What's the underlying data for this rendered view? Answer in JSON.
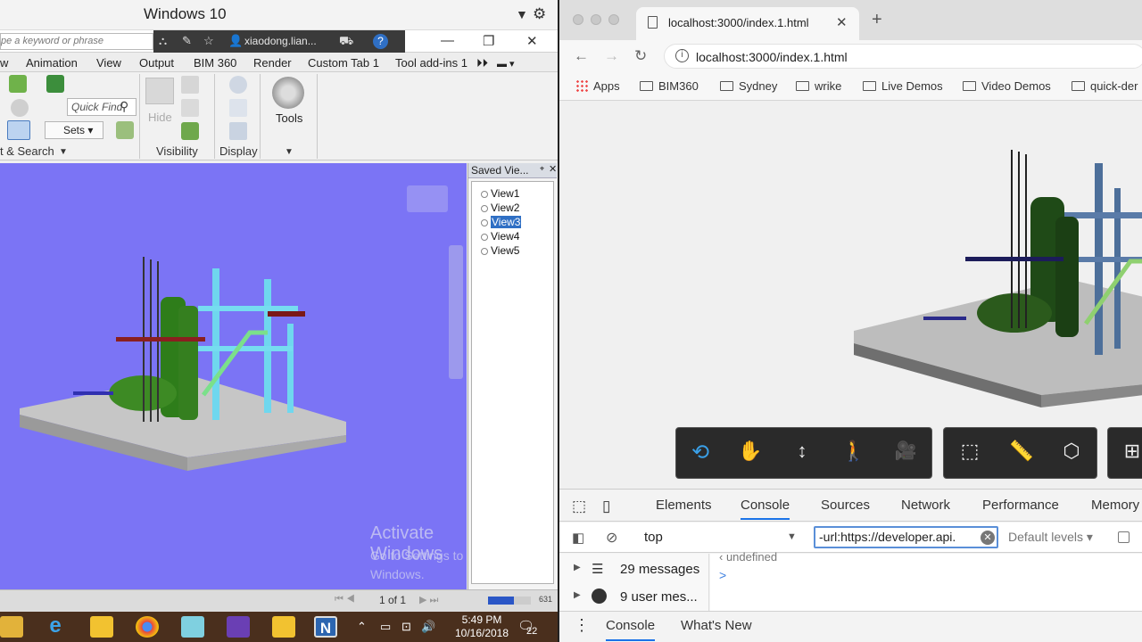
{
  "navisworks": {
    "window_title": "Windows 10",
    "search_placeholder": "pe a keyword or phrase",
    "user": "xiaodong.lian...",
    "menu": [
      "w",
      "Animation",
      "View",
      "Output",
      "BIM 360",
      "Render",
      "Custom Tab 1",
      "Tool add-ins 1"
    ],
    "ribbon": {
      "quick_find": "Quick Find",
      "sets": "Sets",
      "hide": "Hide",
      "tools": "Tools",
      "groups": [
        "t & Search",
        "Visibility",
        "Display"
      ]
    },
    "saved_views": {
      "title": "Saved Vie...",
      "items": [
        {
          "label": "View1",
          "selected": false
        },
        {
          "label": "View2",
          "selected": false
        },
        {
          "label": "View3",
          "selected": true
        },
        {
          "label": "View4",
          "selected": false
        },
        {
          "label": "View5",
          "selected": false
        }
      ]
    },
    "watermark": {
      "title": "Activate Windows",
      "subtitle": "Go to Settings to activate Windows."
    },
    "status": {
      "page": "1 of 1",
      "memory": "631"
    },
    "viewport_bg": "#7b74f5"
  },
  "taskbar": {
    "time": "5:49 PM",
    "date": "10/16/2018",
    "notifications": "22",
    "apps": [
      "file-explorer",
      "internet-explorer",
      "help",
      "chrome",
      "docs",
      "visual-studio",
      "help-2",
      "navisworks"
    ]
  },
  "chrome": {
    "tab_title": "localhost:3000/index.1.html",
    "url": "localhost:3000/index.1.html",
    "bookmarks": [
      "Apps",
      "BIM360",
      "Sydney",
      "wrike",
      "Live Demos",
      "Video Demos",
      "quick-der"
    ],
    "viewer_tools": [
      "orbit",
      "pan",
      "zoom",
      "first-person",
      "camera",
      "explode",
      "measure",
      "section",
      "model-browser"
    ]
  },
  "devtools": {
    "tabs": [
      "Elements",
      "Console",
      "Sources",
      "Network",
      "Performance",
      "Memory"
    ],
    "active_tab": "Console",
    "context": "top",
    "filter_value": "-url:https://developer.api.",
    "levels": "Default levels",
    "sidebar": [
      {
        "label": "29 messages"
      },
      {
        "label": "9 user mes..."
      }
    ],
    "console_prompt": ">",
    "drawer_tabs": [
      "Console",
      "What's New"
    ]
  }
}
